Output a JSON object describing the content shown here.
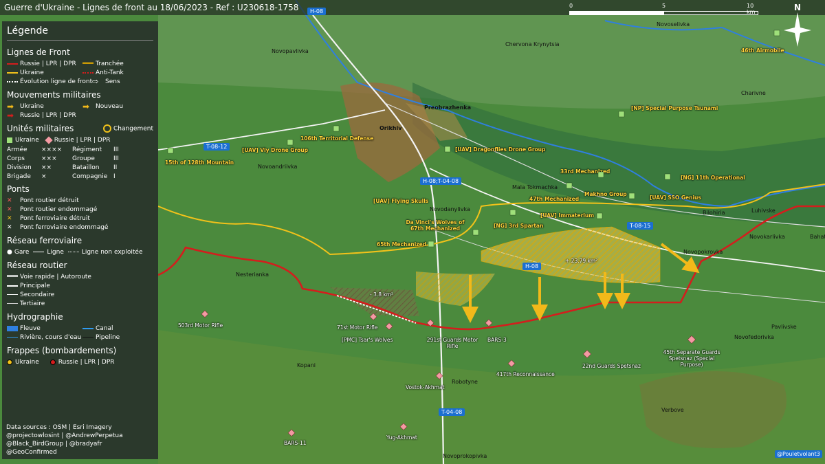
{
  "title": "Guerre d'Ukraine - Lignes de front au 18/06/2023 - Ref : U230618-1758",
  "scale": {
    "ticks": [
      "0",
      "5",
      "10 km"
    ]
  },
  "north_label": "N",
  "legend": {
    "heading": "Légende",
    "front": {
      "title": "Lignes de Front",
      "russia": "Russie | LPR | DPR",
      "ukraine": "Ukraine",
      "evolution": "Évolution ligne de front",
      "trench": "Tranchée",
      "antitank": "Anti-Tank",
      "direction": "Sens"
    },
    "moves": {
      "title": "Mouvements militaires",
      "ukraine": "Ukraine",
      "russia": "Russie | LPR | DPR",
      "new": "Nouveau"
    },
    "units": {
      "title": "Unités militaires",
      "change": "Changement",
      "ukraine": "Ukraine",
      "russia": "Russie | LPR | DPR",
      "table": [
        [
          "Armée",
          "××××",
          "Régiment",
          "III"
        ],
        [
          "Corps",
          "×××",
          "Groupe",
          "III"
        ],
        [
          "Division",
          "××",
          "Bataillon",
          "II"
        ],
        [
          "Brigade",
          "×",
          "Compagnie",
          "I"
        ]
      ]
    },
    "bridges": {
      "title": "Ponts",
      "items": [
        "Pont routier détruit",
        "Pont routier endommagé",
        "Pont ferroviaire détruit",
        "Pont ferroviaire endommagé"
      ]
    },
    "rail": {
      "title": "Réseau ferroviaire",
      "station": "Gare",
      "line": "Ligne",
      "unused": "Ligne non exploitée"
    },
    "roads": {
      "title": "Réseau routier",
      "items": [
        "Voie rapide | Autoroute",
        "Principale",
        "Secondaire",
        "Tertiaire"
      ]
    },
    "hydro": {
      "title": "Hydrographie",
      "river": "Fleuve",
      "canal": "Canal",
      "stream": "Rivière, cours d'eau",
      "pipeline": "Pipeline"
    },
    "strikes": {
      "title": "Frappes (bombardements)",
      "ukraine": "Ukraine",
      "russia": "Russie | LPR | DPR"
    },
    "sources": [
      "Data sources : OSM | Esri Imagery",
      "@projectowlosint | @AndrewPerpetua",
      "@Black_BirdGroup | @bradyafr",
      "@GeoConfirmed"
    ]
  },
  "colors": {
    "russia": "#d41d1d",
    "ukraine": "#f2c21a",
    "hatch": "#f5c518",
    "river": "#2f7fe0"
  },
  "areas": {
    "gain_east": "+ 23.79 km²",
    "gain_west": "- 3.8 km²"
  },
  "roads": [
    "H-08",
    "T-08-12",
    "H-08;T-04-08",
    "T-08-15",
    "H-08",
    "T-04-08"
  ],
  "towns": [
    "Novoselivka",
    "Novopavlivka",
    "Chervona Krynytsia",
    "Preobrazhenka",
    "Orikhiv",
    "Charivne",
    "Novoandriivka",
    "Mala Tokmachka",
    "Novodanylivka",
    "Bilohiria",
    "Luhivske",
    "Novokarlivka",
    "Novopokrovka",
    "Bahate",
    "Nesterianka",
    "Pavlivske",
    "Novofedorivka",
    "Kopani",
    "Robotyne",
    "Verbove",
    "Novoprokopivka"
  ],
  "units_ua": [
    "46th Airmobile",
    "[NP] Special Purpose Tsunami",
    "106th Territorial Defense",
    "[UAV] Viy Drone Group",
    "15th of 128th Mountain",
    "[UAV] Dragonflies Drone Group",
    "33rd Mechanized",
    "[NG] 11th Operational",
    "Makhno Group",
    "[UAV] SSO Genius",
    "47th Mechanized",
    "[UAV] Flying Skulls",
    "[UAV] Immaterium",
    "[NG] 3rd Spartan",
    "Da Vinci's Wolves of 67th Mechanized",
    "65th Mechanized"
  ],
  "units_ru": [
    "503rd Motor Rifle",
    "71st Motor Rifle",
    "[PMC] Tsar's Wolves",
    "291st Guards Motor Rifle",
    "BARS-3",
    "417th Reconnaissance",
    "22nd Guards Spetsnaz",
    "45th Separate Guards Spetsnaz (Special Purpose)",
    "Vostok-Akhmat",
    "Yug-Akhmat",
    "BARS-11"
  ],
  "credit": "@Pouletvolant3"
}
